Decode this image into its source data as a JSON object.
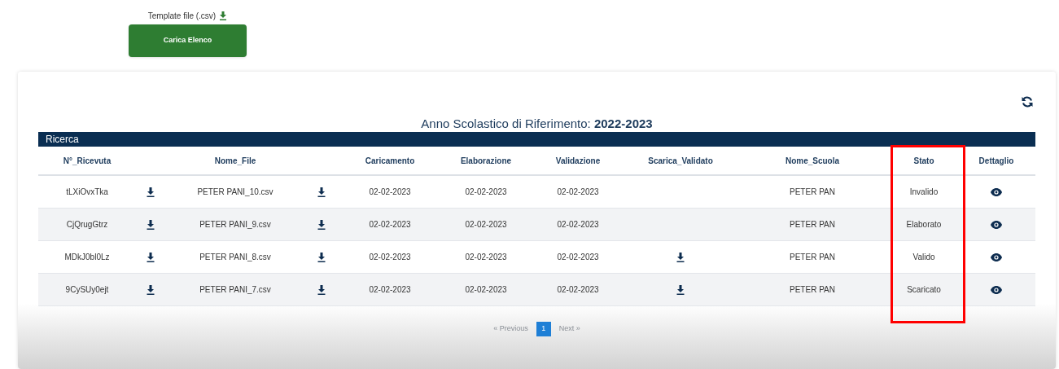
{
  "upload": {
    "template_label": "Template file (.csv)",
    "button": "Carica Elenco"
  },
  "card": {
    "title_prefix": "Anno Scolastico di Riferimento:",
    "title_year": "2022-2023",
    "search_bar": "Ricerca"
  },
  "table": {
    "columns": [
      {
        "label": "N°_Ricevuta",
        "highlighted": false
      },
      {
        "label": "Nome_File",
        "highlighted": false
      },
      {
        "label": "Caricamento",
        "highlighted": false
      },
      {
        "label": "Elaborazione",
        "highlighted": false
      },
      {
        "label": "Validazione",
        "highlighted": false
      },
      {
        "label": "Scarica_Validato",
        "highlighted": false
      },
      {
        "label": "Nome_Scuola",
        "highlighted": false
      },
      {
        "label": "Stato",
        "highlighted": true
      },
      {
        "label": "Dettaglio",
        "highlighted": false
      }
    ],
    "rows": [
      {
        "ricevuta": "tLXiOvxTka",
        "file": "PETER PANI_10.csv",
        "caricamento": "02-02-2023",
        "elaborazione": "02-02-2023",
        "validazione": "02-02-2023",
        "validated_download": false,
        "scuola": "PETER PAN",
        "stato": "Invalido"
      },
      {
        "ricevuta": "CjQrugGtrz",
        "file": "PETER PANI_9.csv",
        "caricamento": "02-02-2023",
        "elaborazione": "02-02-2023",
        "validazione": "02-02-2023",
        "validated_download": false,
        "scuola": "PETER PAN",
        "stato": "Elaborato"
      },
      {
        "ricevuta": "MDkJ0bl0Lz",
        "file": "PETER PANI_8.csv",
        "caricamento": "02-02-2023",
        "elaborazione": "02-02-2023",
        "validazione": "02-02-2023",
        "validated_download": true,
        "scuola": "PETER PAN",
        "stato": "Valido"
      },
      {
        "ricevuta": "9CySUy0ejt",
        "file": "PETER PANI_7.csv",
        "caricamento": "02-02-2023",
        "elaborazione": "02-02-2023",
        "validazione": "02-02-2023",
        "validated_download": true,
        "scuola": "PETER PAN",
        "stato": "Scaricato"
      }
    ]
  },
  "pagination": {
    "previous": {
      "label": "« Previous",
      "disabled": true
    },
    "pages": [
      {
        "label": "1",
        "selected": true
      }
    ],
    "next": {
      "label": "Next »",
      "disabled": true
    }
  }
}
